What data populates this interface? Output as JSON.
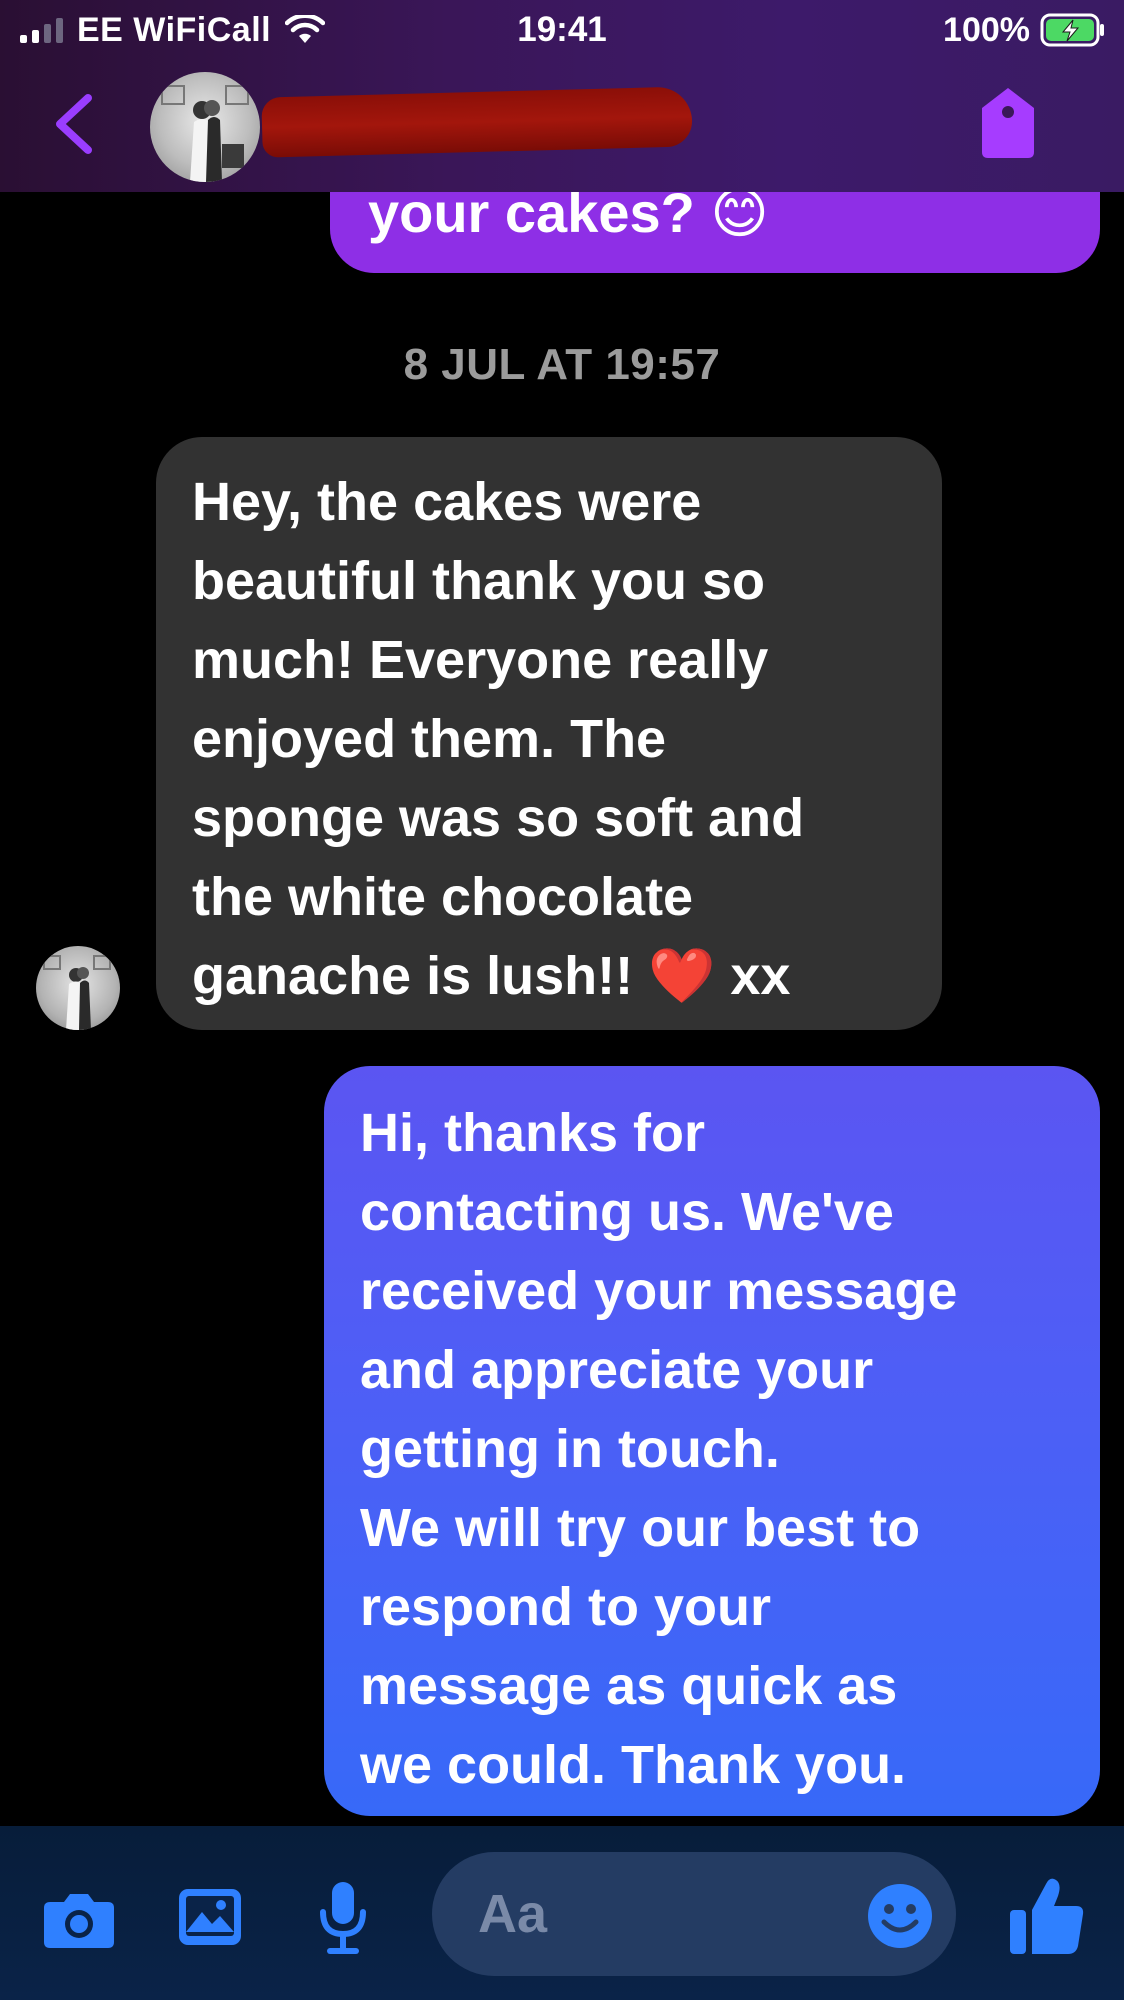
{
  "status_bar": {
    "carrier": "EE WiFiCall",
    "time": "19:41",
    "battery": "100%"
  },
  "header": {
    "contact_name": "",
    "back_icon": "chevron-left-icon",
    "action_icon": "tag-icon"
  },
  "messages": {
    "previous_sent": "your cakes? 😊",
    "timestamp": "8 JUL AT 19:57",
    "received": "Hey, the cakes were\nbeautiful thank you so\nmuch! Everyone really\nenjoyed them. The\nsponge was so soft and\nthe white chocolate\nganache is lush!! ❤️ xx",
    "sent": "Hi, thanks for\ncontacting us. We've\nreceived your message\nand appreciate your\ngetting in touch.\nWe will try our best to\nrespond to your\nmessage as quick as\nwe could. Thank you."
  },
  "composer": {
    "placeholder": "Aa",
    "icons": [
      "camera-icon",
      "image-icon",
      "microphone-icon",
      "emoji-icon",
      "thumbs-up-icon"
    ]
  },
  "colors": {
    "accent": "#8e2fe6",
    "sent_bubble_top": "#5b55f2",
    "sent_bubble_bottom": "#3769f8",
    "received_bubble": "#323232",
    "composer_icons": "#2f80ff"
  }
}
